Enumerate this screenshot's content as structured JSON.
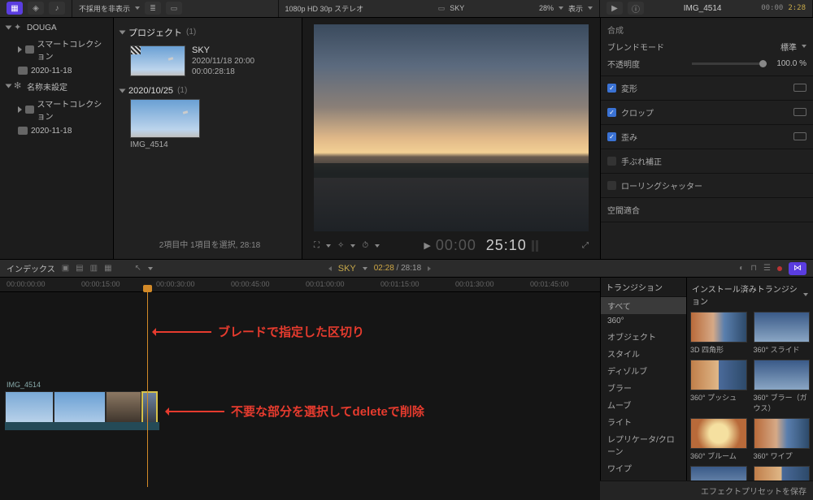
{
  "topbar": {
    "hide_label": "不採用を非表示",
    "format": "1080p HD 30p ステレオ",
    "viewer_title": "SKY",
    "zoom": "28%",
    "view_label": "表示"
  },
  "inspector_head": {
    "title": "IMG_4514",
    "tc": "00:00",
    "len": "2:28"
  },
  "sidebar": {
    "lib": "DOUGA",
    "items": [
      {
        "label": "スマートコレクション"
      },
      {
        "label": "2020-11-18"
      }
    ],
    "lib2": "名称未設定",
    "items2": [
      {
        "label": "スマートコレクション"
      },
      {
        "label": "2020-11-18"
      }
    ]
  },
  "browser": {
    "proj_header": "プロジェクト",
    "proj_count": "(1)",
    "project": {
      "title": "SKY",
      "date": "2020/11/18 20:00",
      "dur": "00:00:28:18"
    },
    "event_header": "2020/10/25",
    "event_count": "(1)",
    "clip": {
      "name": "IMG_4514"
    },
    "footer": "2項目中 1項目を選択, 28:18"
  },
  "viewer": {
    "timecode_lead": "00:00",
    "timecode": "25:10"
  },
  "inspector": {
    "sec_compose": "合成",
    "blend_mode_lbl": "ブレンドモード",
    "blend_mode_val": "標準",
    "opacity_lbl": "不透明度",
    "opacity_val": "100.0 %",
    "transform_lbl": "変形",
    "crop_lbl": "クロップ",
    "distort_lbl": "歪み",
    "stabilize_lbl": "手ぶれ補正",
    "rolling_lbl": "ローリングシャッター",
    "spatial_lbl": "空間適合",
    "save_preset": "エフェクトプリセットを保存"
  },
  "tlbar": {
    "index": "インデックス",
    "title": "SKY",
    "pos_cur": "02:28",
    "pos_total": "28:18"
  },
  "ruler": [
    "00:00:00:00",
    "00:00:15:00",
    "00:00:30:00",
    "00:00:45:00",
    "00:01:00:00",
    "00:01:15:00",
    "00:01:30:00",
    "00:01:45:00"
  ],
  "clip_label": "IMG_4514",
  "annotations": {
    "a1": "ブレードで指定した区切り",
    "a2": "不要な部分を選択してdeleteで削除"
  },
  "transitions": {
    "header": "トランジション",
    "cats": [
      "すべて",
      "360°",
      "オブジェクト",
      "スタイル",
      "ディゾルブ",
      "ブラー",
      "ムーブ",
      "ライト",
      "レプリケータ/クローン",
      "ワイプ"
    ],
    "installed": "インストール済みトランジション",
    "items": [
      "3D 四角形",
      "360° スライド",
      "360° プッシュ",
      "360° ブラー（ガウス）",
      "360° ブルーム",
      "360° ワイプ"
    ]
  }
}
